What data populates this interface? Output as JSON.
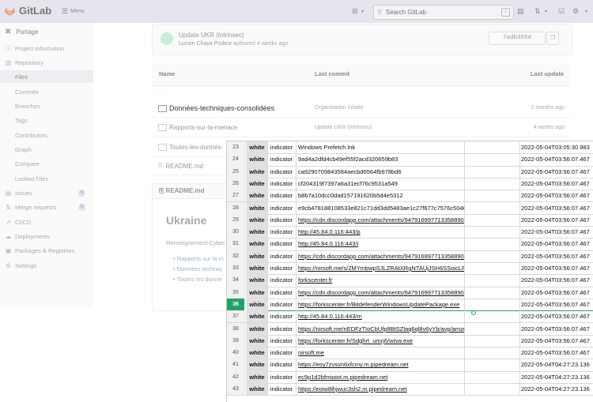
{
  "topbar": {
    "brand": "GitLab",
    "menu_label": "Menu",
    "search_placeholder": "Search GitLab",
    "search_shortcut": "/"
  },
  "sidebar": {
    "project_name": "Partage",
    "items": [
      {
        "label": "Project information",
        "icon": "info-icon"
      },
      {
        "label": "Repository",
        "icon": "repository-icon"
      },
      {
        "label": "Files",
        "icon": ""
      },
      {
        "label": "Commits",
        "icon": ""
      },
      {
        "label": "Branches",
        "icon": ""
      },
      {
        "label": "Tags",
        "icon": ""
      },
      {
        "label": "Contributors",
        "icon": ""
      },
      {
        "label": "Graph",
        "icon": ""
      },
      {
        "label": "Compare",
        "icon": ""
      },
      {
        "label": "Locked Files",
        "icon": ""
      },
      {
        "label": "Issues",
        "icon": "issues-icon",
        "count": "0"
      },
      {
        "label": "Merge requests",
        "icon": "merge-request-icon",
        "count": "0"
      },
      {
        "label": "CI/CD",
        "icon": "rocket-icon"
      },
      {
        "label": "Deployments",
        "icon": "deploy-icon"
      },
      {
        "label": "Packages & Registries",
        "icon": "package-icon"
      },
      {
        "label": "Settings",
        "icon": "gear-icon"
      }
    ]
  },
  "commit": {
    "title": "Update UKR (Intrinsec)",
    "author": "Lucien Chaya Podeur",
    "authored": "authored 4 weeks ago",
    "sha": "7adb305d"
  },
  "file_table": {
    "headers": {
      "name": "Name",
      "last_commit": "Last commit",
      "last_update": "Last update"
    },
    "parent": "..",
    "rows": [
      {
        "name": "Données-techniques-consolidées",
        "message": "Organisation initiale",
        "updated": "2 months ago"
      },
      {
        "name": "Rapports-sur-la-menace",
        "message": "Update UKR (Intrinsec)",
        "updated": "4 weeks ago"
      },
      {
        "name": "Toutes-les-donnés-",
        "message": "",
        "updated": ""
      },
      {
        "name": "README.md",
        "message": "",
        "updated": ""
      }
    ]
  },
  "readme": {
    "file": "README.md",
    "heading": "Ukraine",
    "subtitle": "Renseignement Cyber",
    "links": [
      "Rapports sur la m",
      "Données techniq",
      "Toutes les donné"
    ]
  },
  "sheet": {
    "selected_row": "36",
    "rows": [
      {
        "n": "23",
        "tlp": "white",
        "type": "indicator",
        "value": "Windows Prefetch.lnk",
        "link": false,
        "ts": "2022-05-04T03:05:30.983"
      },
      {
        "n": "24",
        "tlp": "white",
        "type": "indicator",
        "value": "9ad4a2dfd4cb49ef55f2acd320659b83",
        "link": false,
        "ts": "2022-05-04T03:56:07.467"
      },
      {
        "n": "25",
        "tlp": "white",
        "type": "indicator",
        "value": "ca9290709843584aecbd6564fb978bd6",
        "link": false,
        "ts": "2022-05-04T03:56:07.467"
      },
      {
        "n": "26",
        "tlp": "white",
        "type": "indicator",
        "value": "cf204319f7397a6a31ecf76c9531a549",
        "link": false,
        "ts": "2022-05-04T03:56:07.467"
      },
      {
        "n": "27",
        "tlp": "white",
        "type": "indicator",
        "value": "b8b7a10dcc0dad157191620b5d4e5312",
        "link": false,
        "ts": "2022-05-04T03:56:07.467"
      },
      {
        "n": "28",
        "tlp": "white",
        "type": "indicator",
        "value": "e9cb478188108533e821c71dd3dd5483ae1c27f677c7576c5046493321006bac",
        "link": false,
        "ts": "2022-05-04T03:56:07.467"
      },
      {
        "n": "29",
        "tlp": "white",
        "type": "indicator",
        "value": "https://cdn.discordapp.com/attachments/947916997713358890/949948174636810",
        "link": true,
        "ts": "2022-05-04T03:56:07.467"
      },
      {
        "n": "30",
        "tlp": "white",
        "type": "indicator",
        "value": "http://45.84.0.116:443/p",
        "link": true,
        "ts": "2022-05-04T03:56:07.467"
      },
      {
        "n": "31",
        "tlp": "white",
        "type": "indicator",
        "value": "http://45.84.0.116:443/i",
        "link": true,
        "ts": "2022-05-04T03:56:07.467"
      },
      {
        "n": "32",
        "tlp": "white",
        "type": "indicator",
        "value": "https://cdn.discordapp.com/attachments/947916997713358890/949978571680768",
        "link": true,
        "ts": "2022-05-04T03:56:07.467"
      },
      {
        "n": "33",
        "tlp": "white",
        "type": "indicator",
        "value": "https://nirsoft.me/s/2MYmbwpSJLZRAtXRgNTAUjJSH6SSoicLPlrQl/field-keyword",
        "link": true,
        "ts": "2022-05-04T03:56:07.467"
      },
      {
        "n": "34",
        "tlp": "white",
        "type": "indicator",
        "value": "forkscenter.fr",
        "link": true,
        "ts": "2022-05-04T03:56:07.467"
      },
      {
        "n": "35",
        "tlp": "white",
        "type": "indicator",
        "value": "https://cdn.discordapp.com/attachments/947916997713358890/949948174838144",
        "link": true,
        "ts": "2022-05-04T03:56:07.467"
      },
      {
        "n": "36",
        "tlp": "white",
        "type": "indicator",
        "value": "https://forkscenter.fr/BitdefenderWindowsUpdatePackage.exe",
        "link": true,
        "ts": "2022-05-04T03:56:07.467"
      },
      {
        "n": "37",
        "tlp": "white",
        "type": "indicator",
        "value": "http://45.84.0.116:443/m",
        "link": true,
        "ts": "2022-05-04T03:56:07.467"
      },
      {
        "n": "38",
        "tlp": "white",
        "type": "indicator",
        "value": "https://nirsoft.me/nEDFzTIoCbUfp8BtSZlaq6ql8v6yYb/avp/amznussraps/",
        "link": true,
        "ts": "2022-05-04T03:56:07.467"
      },
      {
        "n": "39",
        "tlp": "white",
        "type": "indicator",
        "value": "https://forkscenter.fr/Sdghrt_umrj6/wisw.exe",
        "link": true,
        "ts": "2022-05-04T03:56:07.467"
      },
      {
        "n": "40",
        "tlp": "white",
        "type": "indicator",
        "value": "nirsoft.me",
        "link": true,
        "ts": "2022-05-04T03:56:07.467"
      },
      {
        "n": "41",
        "tlp": "white",
        "type": "indicator",
        "value": "https://eoy7zvsvn6xfcmy.m.pipedream.net",
        "link": true,
        "ts": "2022-05-04T04:27:23.136"
      },
      {
        "n": "42",
        "tlp": "white",
        "type": "indicator",
        "value": "ec9p1d2bfmioiot.m.pipedream.net",
        "link": true,
        "ts": "2022-05-04T04:27:23.136"
      },
      {
        "n": "43",
        "tlp": "white",
        "type": "indicator",
        "value": "https://eoiw8lhjwuc3sh2.m.pipedream.net",
        "link": true,
        "ts": "2022-05-04T04:27:23.136"
      }
    ]
  }
}
